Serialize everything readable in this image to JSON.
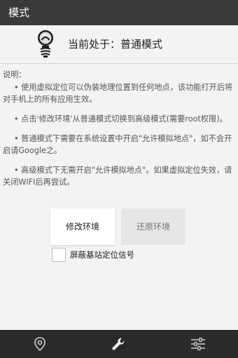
{
  "title": "模式",
  "mode": {
    "prefix": "当前处于：",
    "name": "普通模式"
  },
  "description": {
    "label": "说明：",
    "items": [
      "• 使用虚拟定位可以伪装地理位置到任何地点，该功能打开后将对手机上的所有应用生效。",
      "• 点击'修改环境'从普通模式切换到高级模式(需要root权限)。",
      "• 普通模式下需要在系统设置中开启\"允许模拟地点\"，如不会开启请Google之。",
      "• 高级模式下无需开启\"允许模拟地点\"。如果虚拟定位失效，请关闭WIFI后再尝试。"
    ]
  },
  "buttons": {
    "modify": "修改环境",
    "restore": "还原环境"
  },
  "checkbox": {
    "label": "屏蔽基站定位信号",
    "checked": false
  },
  "nav": {
    "items": [
      {
        "icon": "location-pin-icon"
      },
      {
        "icon": "wrench-icon",
        "active": true
      },
      {
        "icon": "sliders-icon"
      }
    ]
  },
  "colors": {
    "titlebar": "#3a3a3a",
    "bottombar": "#2a2a2a",
    "background": "#f3f3f3"
  }
}
